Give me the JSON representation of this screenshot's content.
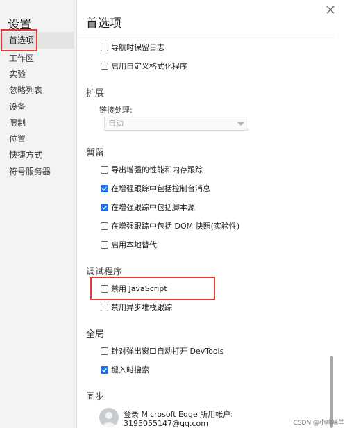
{
  "sidebar": {
    "title": "设置",
    "items": [
      {
        "label": "首选项"
      },
      {
        "label": "工作区"
      },
      {
        "label": "实验"
      },
      {
        "label": "忽略列表"
      },
      {
        "label": "设备"
      },
      {
        "label": "限制"
      },
      {
        "label": "位置"
      },
      {
        "label": "快捷方式"
      },
      {
        "label": "符号服务器"
      }
    ]
  },
  "main": {
    "title": "首选项",
    "top_options": [
      {
        "label": "导航时保留日志",
        "checked": false
      },
      {
        "label": "启用自定义格式化程序",
        "checked": false
      }
    ],
    "extensions": {
      "title": "扩展",
      "link_handling_label": "链接处理:",
      "link_handling_value": "自动"
    },
    "persistence": {
      "title": "暂留",
      "options": [
        {
          "label": "导出增强的性能和内存跟踪",
          "checked": false
        },
        {
          "label": "在增强跟踪中包括控制台消息",
          "checked": true
        },
        {
          "label": "在增强跟踪中包括脚本源",
          "checked": true
        },
        {
          "label": "在增强跟踪中包括 DOM 快照(实验性)",
          "checked": false
        },
        {
          "label": "启用本地替代",
          "checked": false
        }
      ]
    },
    "debugger": {
      "title": "调试程序",
      "options": [
        {
          "label": "禁用 JavaScript",
          "checked": false
        },
        {
          "label": "禁用异步堆栈跟踪",
          "checked": false
        }
      ]
    },
    "global": {
      "title": "全局",
      "options": [
        {
          "label": "针对弹出窗口自动打开 DevTools",
          "checked": false
        },
        {
          "label": "键入时搜索",
          "checked": true
        }
      ]
    },
    "sync": {
      "title": "同步",
      "line1": "登录 Microsoft Edge 所用帐户:",
      "account": "3195055147@qq.com"
    }
  },
  "watermark": "CSDN @小响喵羊",
  "colors": {
    "accent": "#1a73e8",
    "highlight_border": "#e53935",
    "sidebar_bg": "#f3f3f3"
  }
}
